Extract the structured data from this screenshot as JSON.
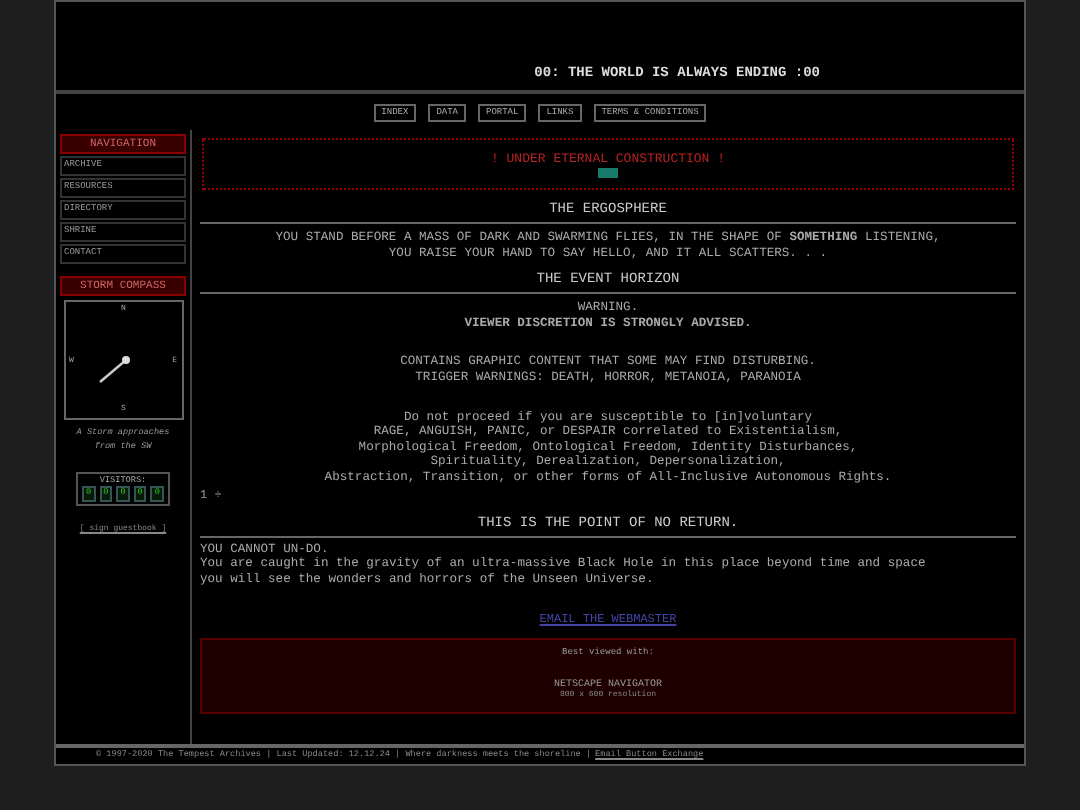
{
  "header": {
    "title": "00: THE WORLD IS ALWAYS ENDING :00"
  },
  "nav_links": [
    {
      "label": "INDEX"
    },
    {
      "label": "DATA"
    },
    {
      "label": "PORTAL"
    },
    {
      "label": "LINKS"
    },
    {
      "label": "TERMS & CONDITIONS"
    }
  ],
  "sidebar": {
    "navigation_title": "NAVIGATION",
    "items": [
      {
        "label": "ARCHIVE"
      },
      {
        "label": "RESOURCES"
      },
      {
        "label": "DIRECTORY"
      },
      {
        "label": "SHRINE"
      },
      {
        "label": "CONTACT"
      }
    ],
    "compass_title": "STORM COMPASS",
    "compass": {
      "n": "N",
      "e": "E",
      "s": "S",
      "w": "W"
    },
    "compass_caption": "A Storm approaches from the SW",
    "visitors_label": "VISITORS:",
    "visitor_digits": [
      "0",
      "0",
      "0",
      "0",
      "0"
    ],
    "guestbook_link": "[ sign guestbook ]"
  },
  "banner": {
    "text": "! UNDER ETERNAL CONSTRUCTION !"
  },
  "sections": [
    {
      "heading": "THE ERGOSPHERE",
      "paragraphs": [
        "YOU STAND BEFORE A MASS OF DARK AND SWARMING FLIES, IN THE SHAPE OF **SOMETHING** LISTENING,\nYOU RAISE YOUR HAND TO SAY HELLO, AND IT ALL SCATTERS. . ."
      ]
    },
    {
      "heading": "THE EVENT HORIZON",
      "paragraphs": [
        "WARNING.",
        "**VIEWER DISCRETION IS STRONGLY ADVISED.**",
        "CONTAINS GRAPHIC CONTENT THAT SOME MAY FIND DISTURBING.\nTRIGGER WARNINGS: DEATH, HORROR, METANOIA, PARANOIA",
        "Do not proceed if you are susceptible to [in]voluntary\nRAGE, ANGUISH, PANIC, or DESPAIR correlated to Existentialism,\nMorphological Freedom, Ontological Freedom, Identity Disturbances,\nSpirituality, Derealization, Depersonalization,\nAbstraction, Transition, or other forms of All-Inclusive Autonomous Rights."
      ]
    }
  ],
  "marker": "1 ÷",
  "final_heading": "THIS IS THE POINT OF NO RETURN.",
  "final_text": [
    "YOU CANNOT UN-DO.",
    "You are caught in the gravity of an ultra-massive Black Hole in this place beyond time and space\nyou will see the wonders and horrors of the Unseen Universe."
  ],
  "email_link": "EMAIL THE WEBMASTER",
  "best_viewed": {
    "label": "Best viewed with:",
    "browser": "NETSCAPE NAVIGATOR",
    "resolution": "800 x 600 resolution"
  },
  "footer": {
    "text": "© 1997-2020 The Tempest Archives | Last Updated: 12.12.24 | Where darkness meets the shoreline |",
    "link": "Email Button Exchange"
  }
}
